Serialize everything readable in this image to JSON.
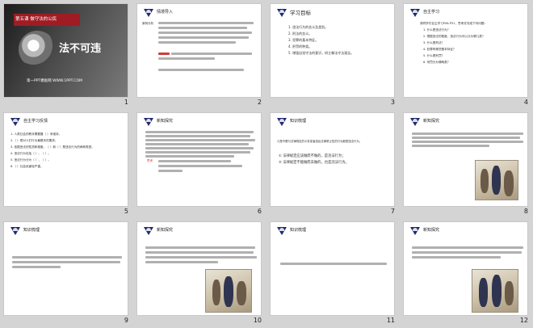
{
  "slides": [
    {
      "number": "1",
      "cover_subtitle": "第五课 做守法的公民",
      "cover_title": "法不可违",
      "cover_footer": "第一PPT模板网 WWW.1PPT.COM"
    },
    {
      "number": "2",
      "heading": "情境导入",
      "side_label": "案例分析"
    },
    {
      "number": "3",
      "heading": "学习目标",
      "items": [
        "1. 违法行为的含义及类别。",
        "2. 刑法的含义。",
        "3. 犯罪的基本特征。",
        "4. 刑罚的种类。",
        "5. 增强自觉守法的意识，树立尊法守法观念。"
      ]
    },
    {
      "number": "4",
      "heading": "自主学习",
      "intro": "请同学们自主学习P46-P51，思考并完成下列问题：",
      "items": [
        "1. 什么是违法行为？",
        "2. 根据违法的程度，违法行为可以分为哪几类？",
        "3. 什么是刑法？",
        "4. 犯罪有哪些基本特征？",
        "5. 什么是刑罚？",
        "6. 刑罚分为哪两类？"
      ]
    },
    {
      "number": "5",
      "heading": "自主学习反馈",
      "items": [
        "1. 人类社会的秩序需要靠（ ）来维持。",
        "2.（ ）是对人们行为最基本的要求。",
        "3. 依据违法的性质和程度，（ ）和（ ）是违法行为的两种类型。",
        "4. 违法行为包括（ ）、（ ）。",
        "5. 违法行为分为（ ）、（ ）。",
        "6.（ ）社会危害较严重。"
      ]
    },
    {
      "number": "6",
      "heading": "新知探究",
      "label": "思考"
    },
    {
      "number": "7",
      "heading": "知识梳理",
      "intro": "凡是不履行法律规定的义务或者违反法律禁止性的行为都是违法行为。",
      "items": [
        "① 法律规定应该做而不做的，是违法行为；",
        "② 法律规定不能做而去做的，也是违法行为。"
      ]
    },
    {
      "number": "8",
      "heading": "新知探究"
    },
    {
      "number": "9",
      "heading": "知识梳理"
    },
    {
      "number": "10",
      "heading": "新知探究"
    },
    {
      "number": "11",
      "heading": "知识梳理"
    },
    {
      "number": "12",
      "heading": "新知探究"
    }
  ],
  "colors": {
    "accent": "#1f2a6e",
    "cover_bar": "#9f1c24",
    "highlight": "#d23b3b"
  }
}
